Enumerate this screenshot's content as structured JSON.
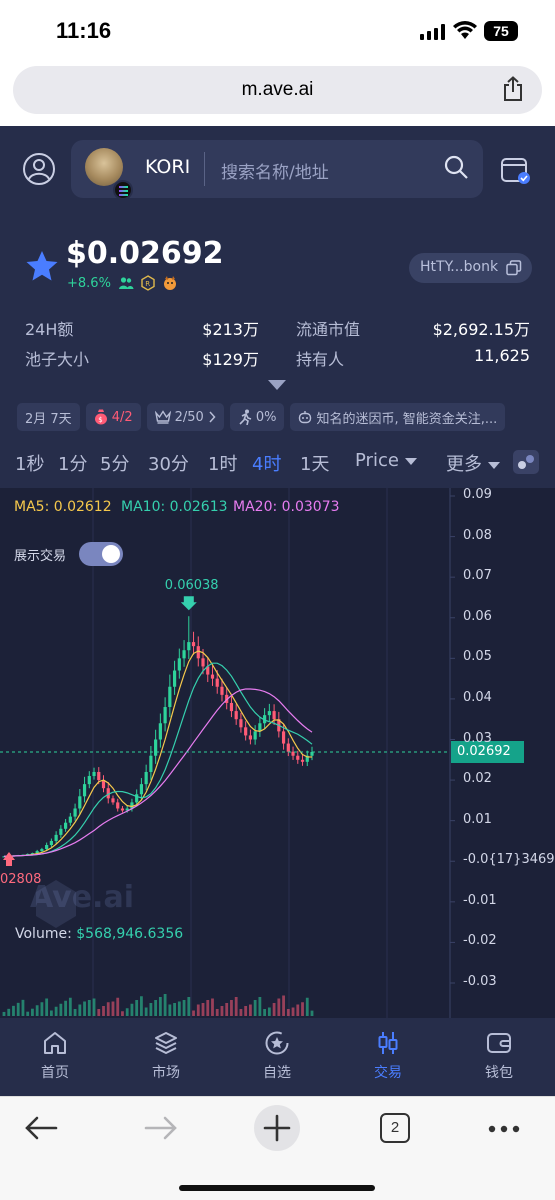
{
  "status_bar": {
    "time": "11:16",
    "battery": "75"
  },
  "browser": {
    "url": "m.ave.ai"
  },
  "header": {
    "token_name": "KORI",
    "search_placeholder": "搜索名称/地址"
  },
  "token": {
    "price": "$0.02692",
    "change": "+8.6%",
    "address_short": "HtTY...bonk",
    "stats": {
      "vol24h_label": "24H额",
      "vol24h_value": "$213万",
      "mcap_label": "流通市值",
      "mcap_value": "$2,692.15万",
      "pool_label": "池子大小",
      "pool_value": "$129万",
      "holders_label": "持有人",
      "holders_value": "11,625"
    },
    "chips": {
      "age": "2月 7天",
      "bag": "4/2",
      "crown": "2/50",
      "runner": "0%",
      "tags": "知名的迷因币, 智能资金关注,..."
    }
  },
  "timeframes": {
    "t1s": "1秒",
    "t1m": "1分",
    "t5m": "5分",
    "t30m": "30分",
    "t1h": "1时",
    "t4h": "4时",
    "t1d": "1天",
    "price_sel": "Price",
    "more": "更多"
  },
  "chart_labels": {
    "ma5": "MA5: 0.02612",
    "ma10": "MA10: 0.02613",
    "ma20": "MA20: 0.03073",
    "show_trades": "展示交易",
    "peak": "0.06038",
    "low": "02808",
    "current_price_tag": "0.02692",
    "watermark": "Ave.ai",
    "volume_label": "Volume:",
    "volume_value": "$568,946.6356"
  },
  "chart_data": {
    "type": "candlestick",
    "yticks": [
      "0.09",
      "0.08",
      "0.07",
      "0.06",
      "0.05",
      "0.04",
      "0.03",
      "0.02",
      "0.01",
      "-0.0{17}3469",
      "-0.01",
      "-0.02",
      "-0.03"
    ],
    "ylim": [
      -0.03,
      0.09
    ],
    "current_price": 0.02692,
    "high_marker": 0.06038,
    "closes": [
      0.0012,
      0.0013,
      0.0014,
      0.0015,
      0.0016,
      0.0018,
      0.002,
      0.0025,
      0.003,
      0.004,
      0.005,
      0.0065,
      0.008,
      0.0095,
      0.011,
      0.013,
      0.016,
      0.019,
      0.021,
      0.022,
      0.02,
      0.018,
      0.0155,
      0.0145,
      0.013,
      0.0125,
      0.013,
      0.0145,
      0.0165,
      0.019,
      0.022,
      0.026,
      0.03,
      0.034,
      0.038,
      0.043,
      0.047,
      0.05,
      0.052,
      0.054,
      0.053,
      0.05,
      0.048,
      0.046,
      0.045,
      0.043,
      0.041,
      0.039,
      0.037,
      0.035,
      0.033,
      0.031,
      0.03,
      0.032,
      0.034,
      0.036,
      0.037,
      0.035,
      0.032,
      0.029,
      0.027,
      0.026,
      0.025,
      0.0245,
      0.026,
      0.02692
    ]
  },
  "nav": {
    "home": "首页",
    "market": "市场",
    "watch": "自选",
    "trade": "交易",
    "wallet": "钱包"
  },
  "safari": {
    "tab_count": "2"
  },
  "colors": {
    "accent": "#4a7dff",
    "up": "#2ed39b",
    "down": "#ff5b76",
    "ma5": "#f5c84c",
    "ma10": "#35d0ae",
    "ma20": "#e77cf0"
  }
}
